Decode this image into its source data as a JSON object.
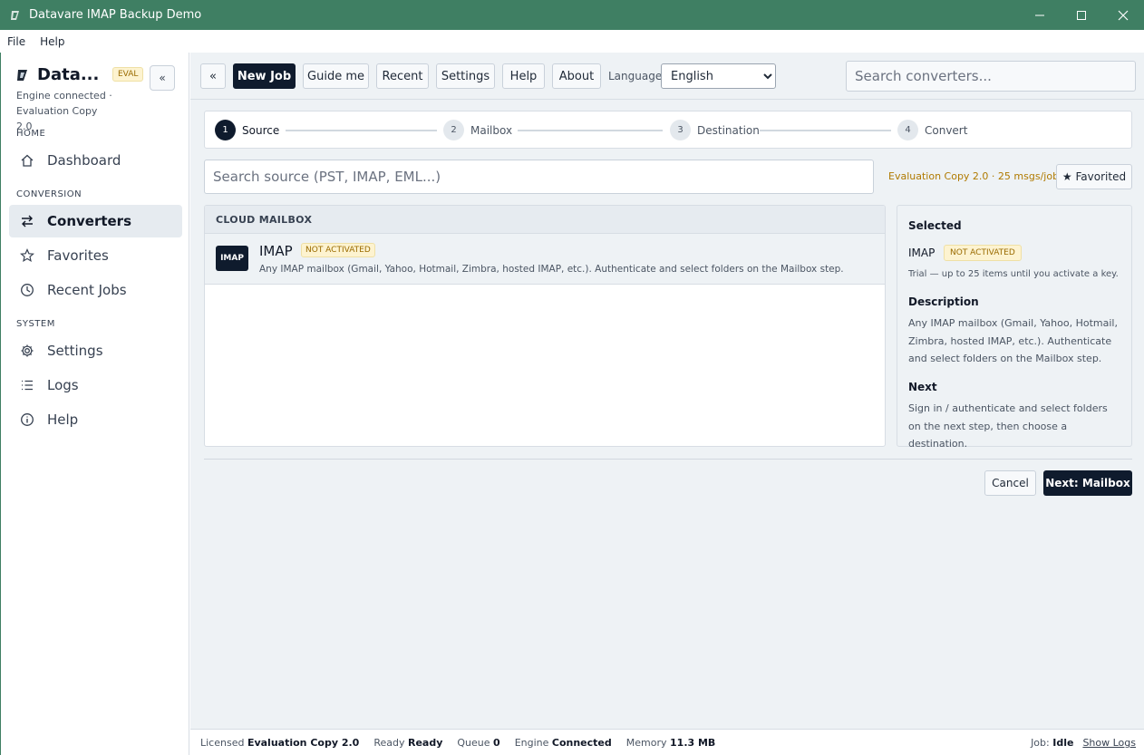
{
  "window": {
    "title": "Datavare IMAP Backup Demo"
  },
  "menu": [
    "File",
    "Help"
  ],
  "sidebar": {
    "brand_name": "Data...",
    "badge": "EVAL",
    "collapse_label": "«",
    "engine_status": "Engine connected · Evaluation Copy 2.0",
    "sections": {
      "home": "HOME",
      "conversion": "CONVERSION",
      "system": "SYSTEM"
    },
    "items": [
      {
        "label": "Dashboard",
        "icon": "home-icon"
      },
      {
        "label": "Converters",
        "icon": "arrows-icon",
        "active": true
      },
      {
        "label": "Favorites",
        "icon": "star-icon"
      },
      {
        "label": "Recent Jobs",
        "icon": "clock-icon"
      },
      {
        "label": "Settings",
        "icon": "gear-icon"
      },
      {
        "label": "Logs",
        "icon": "list-icon"
      },
      {
        "label": "Help",
        "icon": "info-icon"
      }
    ]
  },
  "toolbar": {
    "collapse": "«",
    "new_job": "New Job",
    "guide_me": "Guide me",
    "recent": "Recent",
    "settings": "Settings",
    "help": "Help",
    "about": "About",
    "language_label": "Language",
    "language_value": "English",
    "search_placeholder": "Search converters..."
  },
  "stepper": [
    {
      "num": "1",
      "label": "Source",
      "active": true
    },
    {
      "num": "2",
      "label": "Mailbox"
    },
    {
      "num": "3",
      "label": "Destination"
    },
    {
      "num": "4",
      "label": "Convert"
    }
  ],
  "source": {
    "search_placeholder": "Search source (PST, IMAP, EML...)",
    "eval_note": "Evaluation Copy 2.0 · 25 msgs/job",
    "favorited": "★ Favorited",
    "group_header": "CLOUD MAILBOX",
    "row": {
      "tile": "IMAP",
      "title": "IMAP",
      "badge": "NOT ACTIVATED",
      "description": "Any IMAP mailbox (Gmail, Yahoo, Hotmail, Zimbra, hosted IMAP, etc.). Authenticate and select folders on the Mailbox step."
    }
  },
  "detail": {
    "selected_heading": "Selected",
    "name": "IMAP",
    "badge": "NOT ACTIVATED",
    "trial": "Trial — up to 25 items until you activate a key.",
    "description_heading": "Description",
    "description": "Any IMAP mailbox (Gmail, Yahoo, Hotmail, Zimbra, hosted IMAP, etc.). Authenticate and select folders on the Mailbox step.",
    "next_heading": "Next",
    "next": "Sign in / authenticate and select folders on the next step, then choose a destination."
  },
  "actions": {
    "cancel": "Cancel",
    "next": "Next: Mailbox"
  },
  "status": {
    "licensed_label": "Licensed",
    "licensed_value": "Evaluation Copy 2.0",
    "ready_label": "Ready",
    "ready_value": "Ready",
    "queue_label": "Queue",
    "queue_value": "0",
    "engine_label": "Engine",
    "engine_value": "Connected",
    "memory_label": "Memory",
    "memory_value": "11.3 MB",
    "job_label": "Job:",
    "job_value": "Idle",
    "show_logs": "Show Logs"
  },
  "colors": {
    "titlebar": "#3f7f63",
    "primary": "#0f1b2d",
    "badge": "#fdf3d0",
    "badge_text": "#9a6b00"
  }
}
